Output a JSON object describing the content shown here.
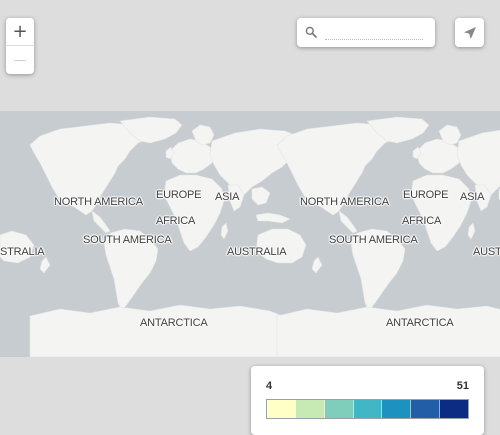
{
  "zoom": {
    "in_label": "+",
    "out_label": "—"
  },
  "search": {
    "value": "",
    "placeholder": ""
  },
  "map": {
    "water_color": "#c7ccd1",
    "land_color": "#f4f4f2",
    "labels": {
      "north_america_1": "NORTH AMERICA",
      "south_america_1": "SOUTH AMERICA",
      "europe_1": "EUROPE",
      "africa_1": "AFRICA",
      "asia_1": "ASIA",
      "australia_1": "AUSTRALIA",
      "antarctica_1": "ANTARCTICA",
      "australia_left": "STRALIA",
      "north_america_2": "NORTH AMERICA",
      "south_america_2": "SOUTH AMERICA",
      "europe_2": "EUROPE",
      "africa_2": "AFRICA",
      "asia_2": "ASIA",
      "australia_right": "AUST",
      "antarctica_2": "ANTARCTICA"
    }
  },
  "legend": {
    "min": "4",
    "max": "51",
    "colors": [
      "#ffffc6",
      "#c7e9b4",
      "#7fcdbb",
      "#41b6c4",
      "#1d91c0",
      "#225ea8",
      "#0c2c84"
    ]
  },
  "icons": {
    "zoom_in": "plus-icon",
    "zoom_out": "minus-icon",
    "search": "search-icon",
    "locate": "navigation-arrow-icon"
  }
}
